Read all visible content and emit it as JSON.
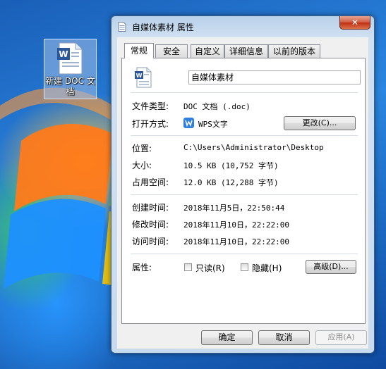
{
  "desktop": {
    "icon_label": "新建 DOC 文档"
  },
  "window": {
    "title": "自媒体素材 属性",
    "close_label": "✕"
  },
  "tabs": [
    {
      "label": "常规",
      "active": true
    },
    {
      "label": "安全",
      "active": false
    },
    {
      "label": "自定义",
      "active": false
    },
    {
      "label": "详细信息",
      "active": false
    },
    {
      "label": "以前的版本",
      "active": false
    }
  ],
  "general": {
    "file_name": "自媒体素材",
    "file_type_label": "文件类型:",
    "file_type_value": "DOC 文档 (.doc)",
    "open_with_label": "打开方式:",
    "open_with_value": "WPS文字",
    "change_button": "更改(C)...",
    "location_label": "位置:",
    "location_value": "C:\\Users\\Administrator\\Desktop",
    "size_label": "大小:",
    "size_value": "10.5 KB (10,752 字节)",
    "disk_size_label": "占用空间:",
    "disk_size_value": "12.0 KB (12,288 字节)",
    "created_label": "创建时间:",
    "created_value": "2018年11月5日，22:50:44",
    "modified_label": "修改时间:",
    "modified_value": "2018年11月10日，22:22:00",
    "accessed_label": "访问时间:",
    "accessed_value": "2018年11月10日，22:22:00",
    "attributes_label": "属性:",
    "readonly_label": "只读(R)",
    "hidden_label": "隐藏(H)",
    "advanced_button": "高级(D)..."
  },
  "footer": {
    "ok": "确定",
    "cancel": "取消",
    "apply": "应用(A)"
  },
  "colors": {
    "wps_blue": "#2f7fe0",
    "doc_blue": "#2b579a"
  }
}
